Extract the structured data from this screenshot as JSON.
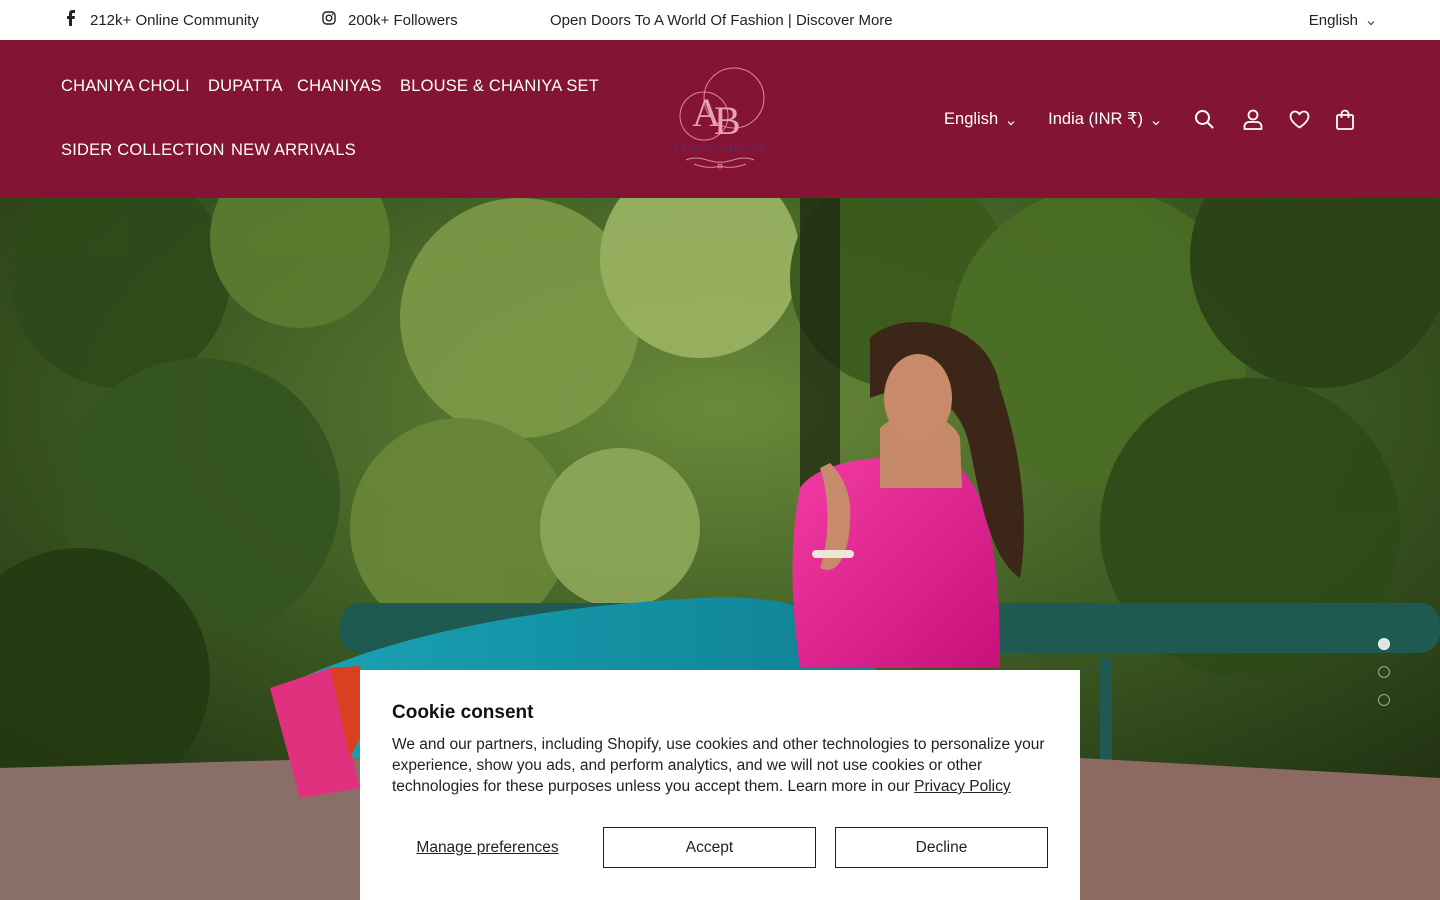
{
  "topbar": {
    "community_text": "212k+ Online Community",
    "followers_text": "200k+ Followers",
    "announcement": "Open Doors To A World Of Fashion | Discover More",
    "language": "English"
  },
  "header": {
    "nav": [
      {
        "label": "CHANIYA CHOLI"
      },
      {
        "label": "DUPATTA"
      },
      {
        "label": "CHANIYAS"
      },
      {
        "label": "BLOUSE & CHANIYA SET"
      },
      {
        "label": "SIDER COLLECTION"
      },
      {
        "label": "NEW ARRIVALS"
      }
    ],
    "logo": {
      "initials": "AB",
      "name": "LEHENGA HOUSE"
    },
    "language": "English",
    "country": "India (INR ₹)",
    "icons": [
      "search-icon",
      "account-icon",
      "wishlist-icon",
      "cart-icon"
    ]
  },
  "hero": {
    "slides_count": 3,
    "active_slide": 1
  },
  "cookie": {
    "title": "Cookie consent",
    "body": "We and our partners, including Shopify, use cookies and other technologies to personalize your experience, show you ads, and perform analytics, and we will not use cookies or other technologies for these purposes unless you accept them. Learn more in our ",
    "privacy_link": "Privacy Policy",
    "manage_label": "Manage preferences",
    "accept_label": "Accept",
    "decline_label": "Decline"
  },
  "colors": {
    "header_bg": "#841434",
    "accent_pink": "#e51f8e",
    "accent_teal": "#1aa3b5"
  }
}
